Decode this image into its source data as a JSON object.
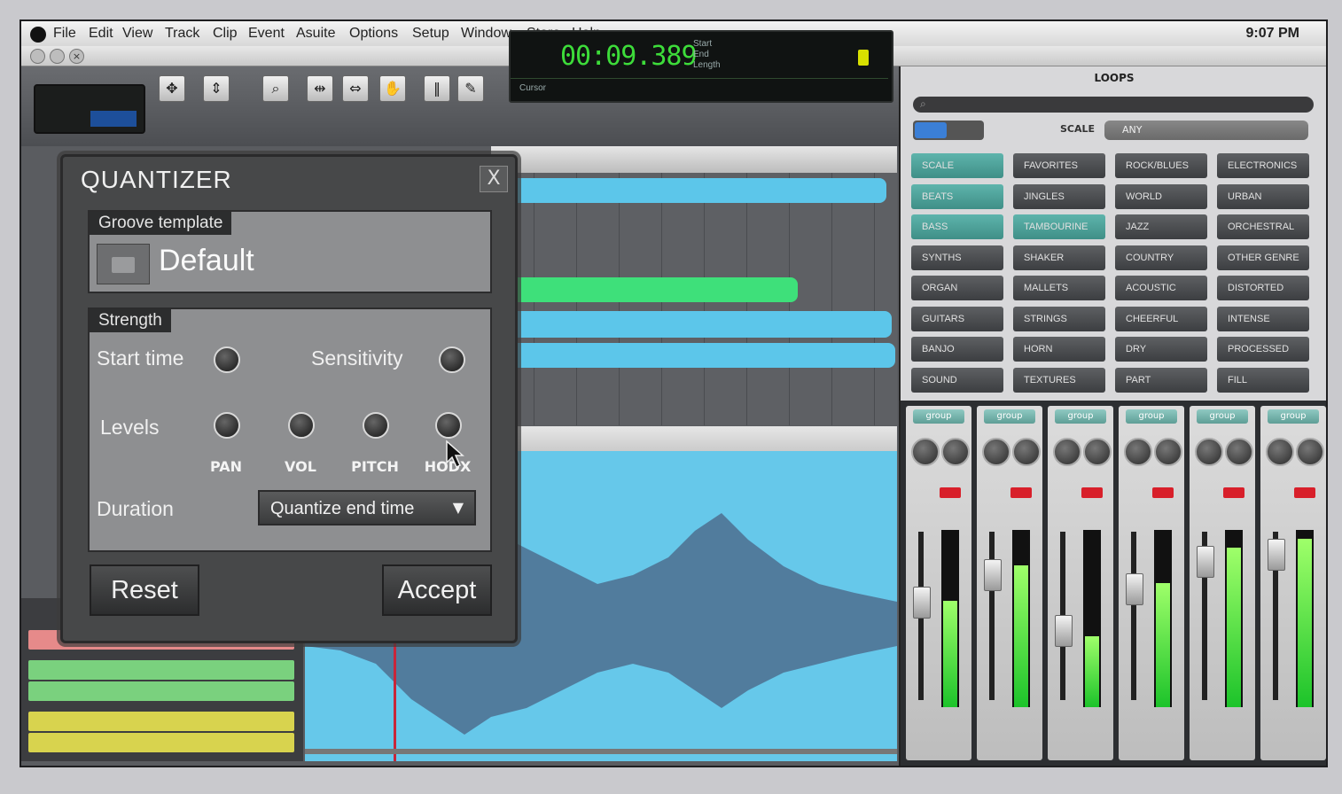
{
  "menubar": {
    "items": [
      "File",
      "Edit",
      "View",
      "Track",
      "Clip",
      "Event",
      "Asuite",
      "Options",
      "Setup",
      "Window",
      "Store",
      "Help"
    ],
    "clock": "9:07 PM"
  },
  "window_controls": {
    "close": "×"
  },
  "transport": {
    "timecode": "00:09.389",
    "labels": {
      "start": "Start",
      "end": "End",
      "length": "Length",
      "cursor": "Cursor"
    }
  },
  "loops": {
    "title": "LOOPS",
    "scale_label": "SCALE",
    "scale_value": "ANY",
    "categories": [
      [
        "SCALE",
        "FAVORITES",
        "ROCK/BLUES",
        "ELECTRONICS"
      ],
      [
        "BEATS",
        "JINGLES",
        "WORLD",
        "URBAN"
      ],
      [
        "BASS",
        "TAMBOURINE",
        "JAZZ",
        "ORCHESTRAL"
      ],
      [
        "SYNTHS",
        "SHAKER",
        "COUNTRY",
        "OTHER GENRE"
      ],
      [
        "ORGAN",
        "MALLETS",
        "ACOUSTIC",
        "DISTORTED"
      ],
      [
        "GUITARS",
        "STRINGS",
        "CHEERFUL",
        "INTENSE"
      ],
      [
        "BANJO",
        "HORN",
        "DRY",
        "PROCESSED"
      ],
      [
        "SOUND EFFECTS",
        "TEXTURES",
        "PART",
        "FILL"
      ]
    ]
  },
  "mixer": {
    "group_label": "group",
    "strips": [
      {
        "level": 0.6
      },
      {
        "level": 0.8
      },
      {
        "level": 0.4
      },
      {
        "level": 0.7
      },
      {
        "level": 0.9
      },
      {
        "level": 0.95
      }
    ]
  },
  "quantizer": {
    "title": "QUANTIZER",
    "close": "X",
    "groove_label": "Groove template",
    "groove_value": "Default",
    "strength_label": "Strength",
    "start_time": "Start time",
    "sensitivity": "Sensitivity",
    "levels": "Levels",
    "level_knobs": [
      "PAN",
      "VOL",
      "PITCH",
      "HODX"
    ],
    "duration": "Duration",
    "duration_value": "Quantize end time",
    "reset": "Reset",
    "accept": "Accept"
  },
  "icons": [
    "apple-icon",
    "folder-icon",
    "search-icon",
    "zoom-icon",
    "cursor-arrow-icon",
    "dropdown-arrow-icon"
  ],
  "colors": {
    "clip_blue": "#5cc6ea",
    "clip_green": "#3ee07a",
    "lcd_green": "#3ddc3a",
    "accent_teal": "#4f9f97",
    "record_red": "#d81f2a"
  }
}
